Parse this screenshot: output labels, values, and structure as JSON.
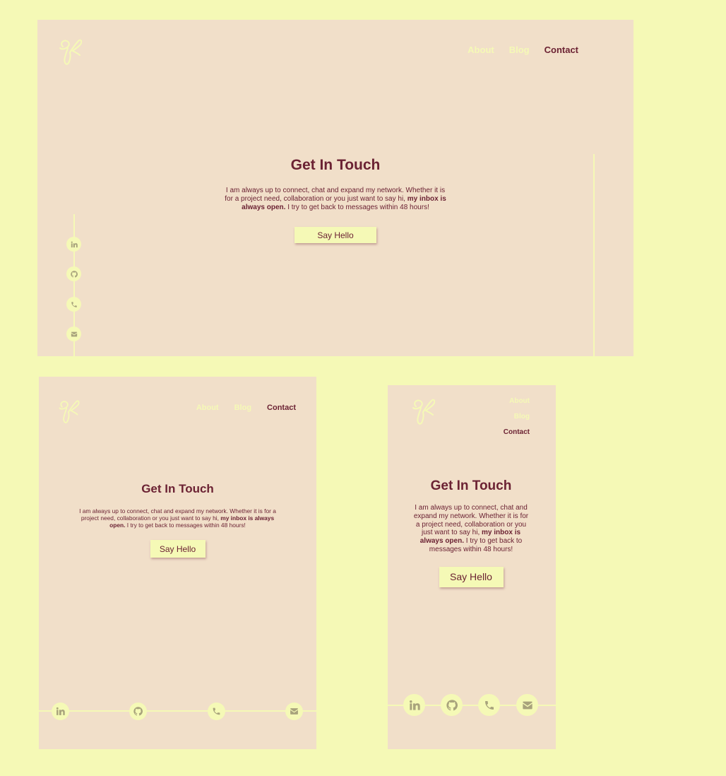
{
  "nav": {
    "about": "About",
    "blog": "Blog",
    "contact": "Contact"
  },
  "contact": {
    "title": "Get In Touch",
    "text_before": "I am always up to connect, chat and expand my network. Whether it is for a project need, collaboration or you just want to say hi,",
    "text_bold": "my inbox is always open.",
    "text_after": "I try to get back to messages within 48 hours!",
    "button_label": "Say Hello"
  },
  "social": [
    "linkedin-icon",
    "github-icon",
    "phone-icon",
    "email-icon"
  ],
  "colors": {
    "background": "#f5f9b6",
    "panel": "#f1dfc9",
    "accent": "#f5f9b6",
    "text": "#6b2233",
    "icon_glyph": "#a8a37c"
  }
}
